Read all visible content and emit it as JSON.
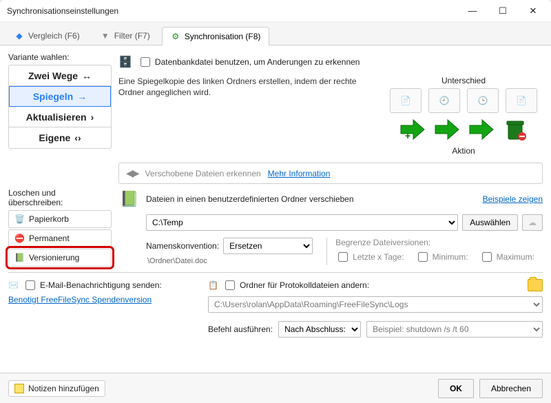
{
  "window": {
    "title": "Synchronisationseinstellungen"
  },
  "tabs": {
    "compare": "Vergleich (F6)",
    "filter": "Filter (F7)",
    "sync": "Synchronisation (F8)"
  },
  "variant": {
    "label": "Variante wahlen:",
    "items": [
      {
        "label": "Zwei Wege",
        "glyph": "↔"
      },
      {
        "label": "Spiegeln",
        "glyph": "→",
        "selected": true
      },
      {
        "label": "Aktualisieren",
        "glyph": "›"
      },
      {
        "label": "Eigene",
        "glyph": "‹›"
      }
    ]
  },
  "database": {
    "checkbox_label": "Datenbankdatei benutzen, um Anderungen zu erkennen"
  },
  "description": "Eine Spiegelkopie des linken Ordners erstellen, indem der rechte Ordner angeglichen wird.",
  "actions": {
    "unterschied": "Unterschied",
    "aktion": "Aktion"
  },
  "moved": {
    "text": "Verschobene Dateien erkennen",
    "link": "Mehr Information"
  },
  "delete": {
    "label": "Loschen und überschreiben:",
    "items": [
      {
        "label": "Papierkorb"
      },
      {
        "label": "Permanent"
      },
      {
        "label": "Versionierung",
        "selected": true
      }
    ]
  },
  "versioning": {
    "desc": "Dateien in einen benutzerdefinierten Ordner verschieben",
    "examples_link": "Beispiele zeigen",
    "path": "C:\\Temp",
    "browse": "Auswählen",
    "naming_label": "Namenskonvention:",
    "naming_value": "Ersetzen",
    "naming_hint": "\\Ordner\\Datei.doc",
    "limits_title": "Begrenze Dateiversionen:",
    "limit_days": "Letzte x Tage:",
    "limit_min": "Minimum:",
    "limit_max": "Maximum:"
  },
  "email": {
    "checkbox_label": "E-Mail-Benachrichtigung senden:",
    "donation_link": "Benotigt FreeFileSync Spendenversion"
  },
  "protocol": {
    "checkbox_label": "Ordner für Protokolldateien andern:",
    "path": "C:\\Users\\rolan\\AppData\\Roaming\\FreeFileSync\\Logs"
  },
  "command": {
    "label": "Befehl ausführen:",
    "when": "Nach Abschluss:",
    "example": "Beispiel: shutdown /s /t 60"
  },
  "footer": {
    "notes": "Notizen hinzufügen",
    "ok": "OK",
    "cancel": "Abbrechen"
  }
}
